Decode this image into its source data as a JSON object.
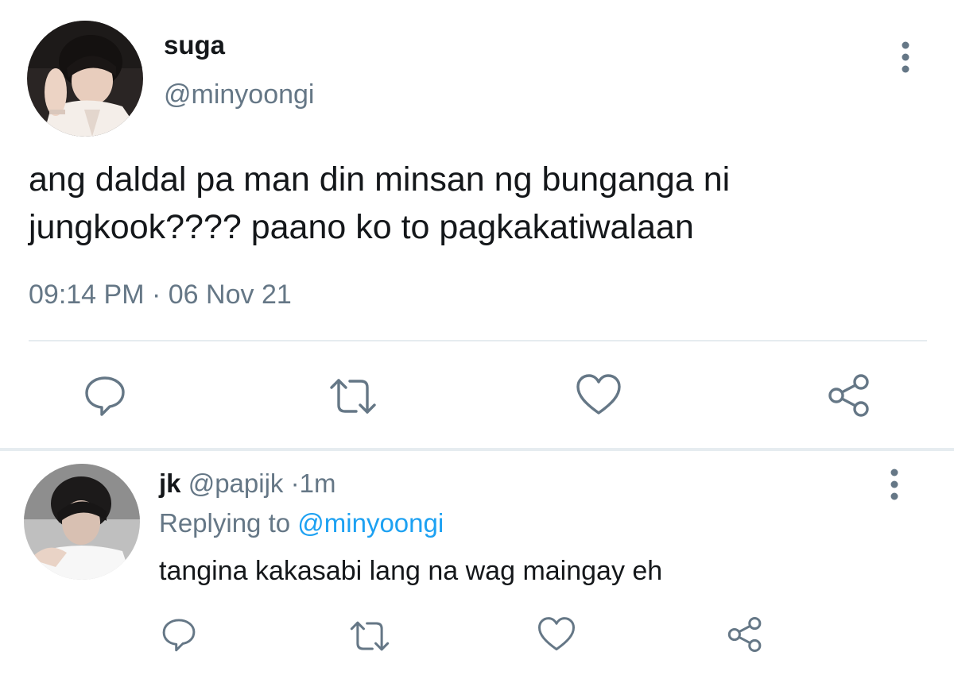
{
  "main_tweet": {
    "display_name": "suga",
    "handle": "@minyoongi",
    "text": "ang daldal pa man din minsan ng bunganga ni jungkook???? paano ko to pagkakatiwalaan",
    "time": "09:14 PM",
    "separator": "·",
    "date": "06 Nov 21",
    "icons": {
      "more": "more-vertical-icon",
      "reply": "reply-bubble-icon",
      "retweet": "retweet-icon",
      "like": "heart-icon",
      "share": "share-icon"
    }
  },
  "reply_tweet": {
    "display_name": "jk",
    "handle": "@papijk",
    "separator": "·",
    "age": "1m",
    "replying_label": "Replying to",
    "replying_to": "@minyoongi",
    "text": "tangina kakasabi lang na wag maingay eh",
    "icons": {
      "more": "more-vertical-icon",
      "reply": "reply-bubble-icon",
      "retweet": "retweet-icon",
      "like": "heart-icon",
      "share": "share-icon"
    }
  },
  "colors": {
    "text": "#14171a",
    "secondary": "#657786",
    "link": "#1da1f2",
    "divider": "#e6ecf0",
    "icon": "#657786"
  }
}
